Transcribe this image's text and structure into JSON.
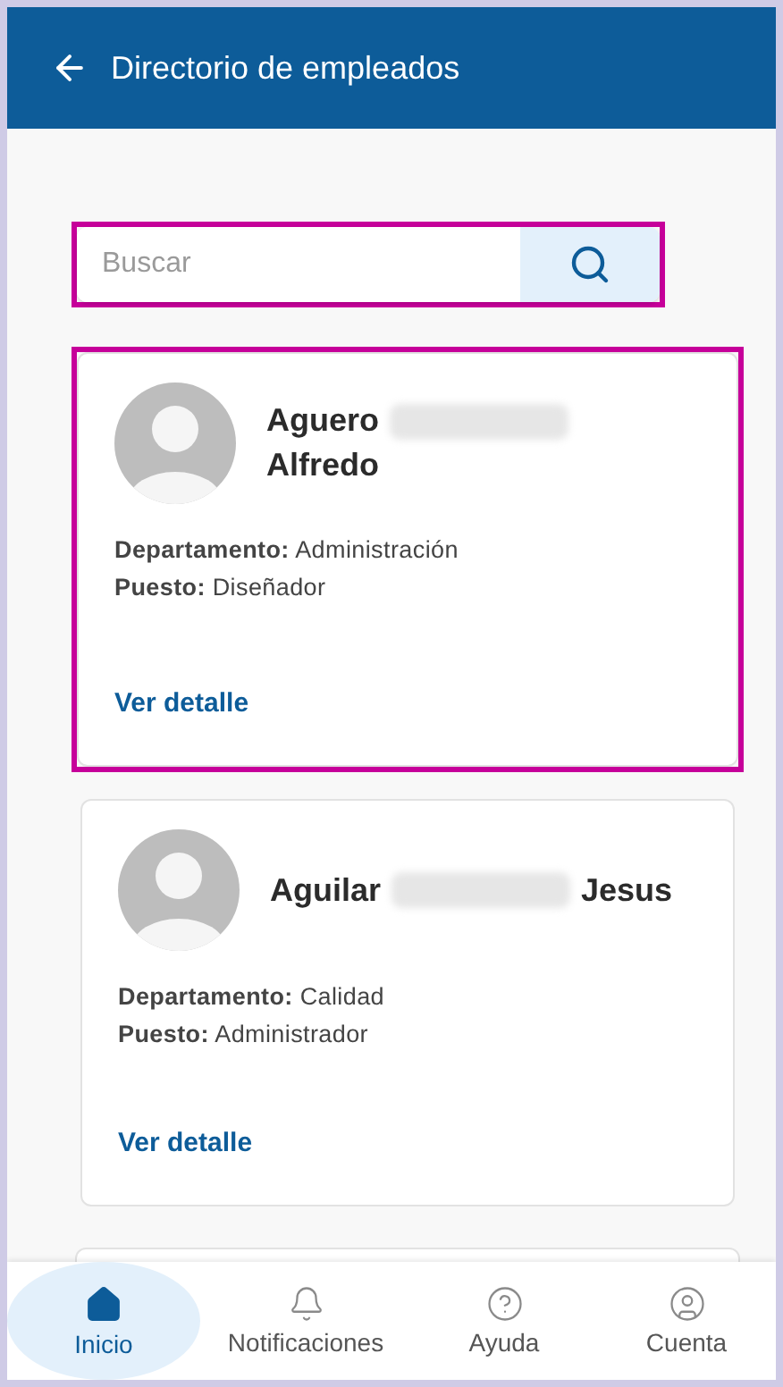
{
  "header": {
    "title": "Directorio de empleados"
  },
  "search": {
    "placeholder": "Buscar",
    "highlighted": true
  },
  "employees": [
    {
      "name_start": "Aguero",
      "name_end": "Alfredo",
      "redacted": true,
      "highlighted": true,
      "fields": [
        {
          "label": "Departamento:",
          "value": "Administración"
        },
        {
          "label": "Puesto:",
          "value": "Diseñador"
        }
      ],
      "link": "Ver detalle"
    },
    {
      "name_start": "Aguilar",
      "name_end": "Jesus",
      "redacted": true,
      "highlighted": false,
      "fields": [
        {
          "label": "Departamento:",
          "value": "Calidad"
        },
        {
          "label": "Puesto:",
          "value": "Administrador"
        }
      ],
      "link": "Ver detalle"
    }
  ],
  "nav": [
    {
      "kind": "home",
      "label": "Inicio",
      "selected": true
    },
    {
      "kind": "bell",
      "label": "Notificaciones",
      "selected": false
    },
    {
      "kind": "help",
      "label": "Ayuda",
      "selected": false
    },
    {
      "kind": "account",
      "label": "Cuenta",
      "selected": false
    }
  ]
}
